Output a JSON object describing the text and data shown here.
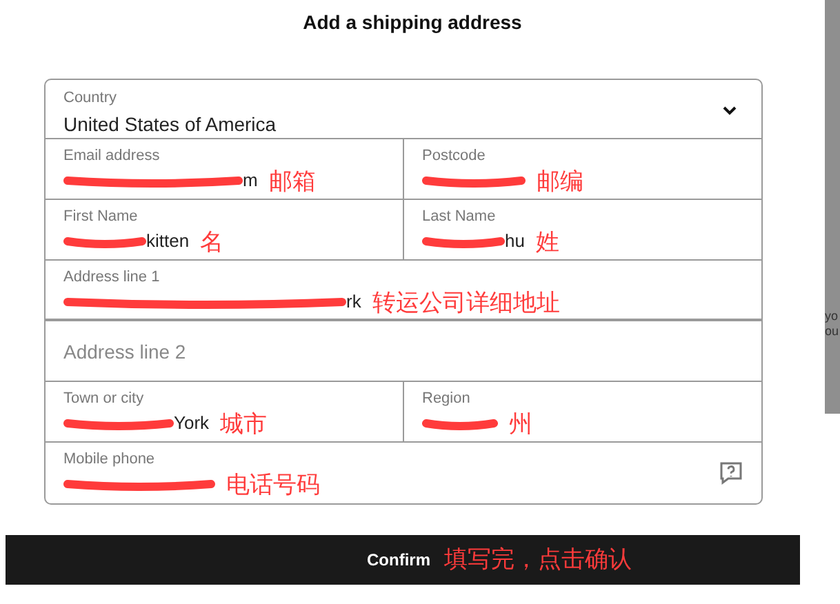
{
  "dialog": {
    "title": "Add a shipping address"
  },
  "country": {
    "label": "Country",
    "value": "United States of America"
  },
  "rows": [
    [
      {
        "label": "Email address",
        "value": "m",
        "redacted": true,
        "note": "邮箱"
      },
      {
        "label": "Postcode",
        "redacted": true,
        "note": "邮编"
      }
    ],
    [
      {
        "label": "First Name",
        "value": "kitten",
        "redacted": true,
        "note": "名"
      },
      {
        "label": "Last Name",
        "value": "hu",
        "redacted": true,
        "note": "姓"
      }
    ],
    [
      {
        "label": "Address line 1",
        "value": "rk",
        "redacted": true,
        "note": "转运公司详细地址"
      }
    ],
    [
      {
        "placeholder": "Address line 2"
      }
    ],
    [
      {
        "label": "Town or city",
        "value": "York",
        "redacted": true,
        "note": "城市"
      },
      {
        "label": "Region",
        "redacted": true,
        "note": "州"
      }
    ],
    [
      {
        "label": "Mobile phone",
        "redacted": true,
        "note": "电话号码",
        "help": true
      }
    ]
  ],
  "confirm": {
    "label": "Confirm",
    "note": "填写完，点击确认"
  },
  "backdrop": {
    "lines": [
      "yo",
      "ou"
    ]
  }
}
